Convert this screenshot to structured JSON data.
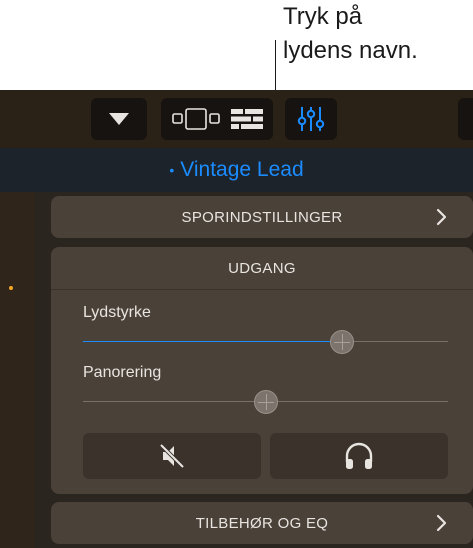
{
  "callout": {
    "line1": "Tryk på",
    "line2": "lydens navn."
  },
  "toolbar": {
    "icons": [
      "triangle-down-icon",
      "smart-controls-icon",
      "tracks-icon",
      "mixer-icon"
    ]
  },
  "title": {
    "dot": "•",
    "name": "Vintage Lead"
  },
  "sections": {
    "track_settings_label": "SPORINDSTILLINGER",
    "output_label": "UDGANG",
    "plugins_label": "TILBEHØR OG EQ"
  },
  "output": {
    "volume_label": "Lydstyrke",
    "volume_fraction": 0.71,
    "pan_label": "Panorering",
    "pan_fraction": 0.5,
    "mute_icon": "speaker-muted-icon",
    "solo_icon": "headphones-icon"
  },
  "colors": {
    "accent": "#1a8cff",
    "track_dot": "#f5a623",
    "active_mixer": "#1a8cff"
  }
}
